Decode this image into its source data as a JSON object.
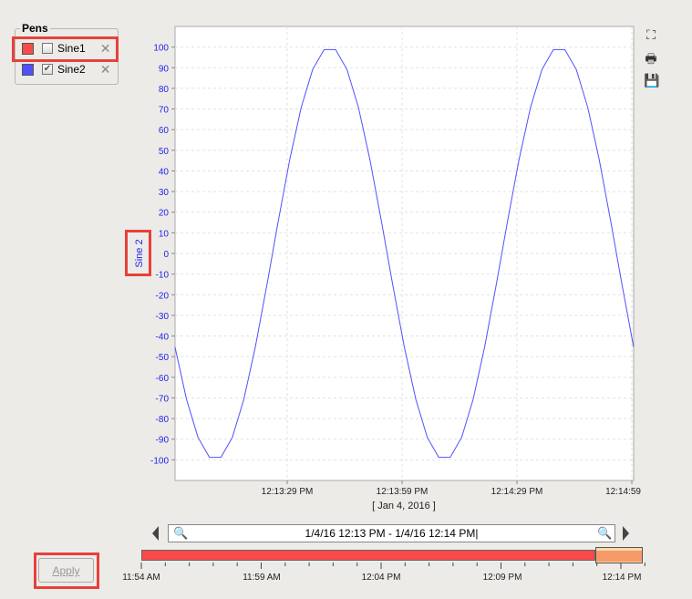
{
  "pens": {
    "title": "Pens",
    "items": [
      {
        "name": "Sine1",
        "color": "#f74b4b",
        "checked": false,
        "highlighted": true
      },
      {
        "name": "Sine2",
        "color": "#5050ff",
        "checked": true,
        "highlighted": false
      }
    ]
  },
  "chart_data": {
    "type": "line",
    "ylabel": "Sine 2",
    "xlabel": "[ Jan 4, 2016 ]",
    "ylim": [
      -110,
      110
    ],
    "yticks": [
      100,
      90,
      80,
      70,
      60,
      50,
      40,
      30,
      20,
      10,
      0,
      -10,
      -20,
      -30,
      -40,
      -50,
      -60,
      -70,
      -80,
      -90,
      -100
    ],
    "xlim": [
      "12:13:00",
      "12:15:00"
    ],
    "xticks": [
      "12:13:29 PM",
      "12:13:59 PM",
      "12:14:29 PM",
      "12:14:59"
    ],
    "grid": true,
    "series": [
      {
        "color": "#5050ff",
        "x": [
          "12:13:00",
          "12:13:03",
          "12:13:06",
          "12:13:09",
          "12:13:12",
          "12:13:15",
          "12:13:18",
          "12:13:21",
          "12:13:24",
          "12:13:27",
          "12:13:30",
          "12:13:33",
          "12:13:36",
          "12:13:39",
          "12:13:42",
          "12:13:45",
          "12:13:48",
          "12:13:51",
          "12:13:54",
          "12:13:57",
          "12:14:00",
          "12:14:03",
          "12:14:06",
          "12:14:09",
          "12:14:12",
          "12:14:15",
          "12:14:18",
          "12:14:21",
          "12:14:24",
          "12:14:27",
          "12:14:30",
          "12:14:33",
          "12:14:36",
          "12:14:39",
          "12:14:42",
          "12:14:45",
          "12:14:48",
          "12:14:51",
          "12:14:54",
          "12:14:57",
          "12:15:00"
        ],
        "values": [
          -45.4,
          -70.7,
          -89.1,
          -98.8,
          -98.8,
          -89.1,
          -70.7,
          -45.4,
          -15.6,
          15.6,
          45.4,
          70.7,
          89.1,
          98.8,
          98.8,
          89.1,
          70.7,
          45.4,
          15.6,
          -15.6,
          -45.4,
          -70.7,
          -89.1,
          -98.8,
          -98.8,
          -89.1,
          -70.7,
          -45.4,
          -15.6,
          15.6,
          45.4,
          70.7,
          89.1,
          98.8,
          98.8,
          89.1,
          70.7,
          45.4,
          15.6,
          -15.6,
          -45.4
        ]
      }
    ]
  },
  "toolbar": {
    "icons": [
      "zoom-fit-icon",
      "print-icon",
      "save-icon"
    ]
  },
  "range": {
    "text": "1/4/16 12:13 PM - 1/4/16 12:14 PM",
    "zoom_out": "zoom-out-icon",
    "zoom_in": "zoom-in-icon"
  },
  "timeline": {
    "labels": [
      "11:54 AM",
      "11:59 AM",
      "12:04 PM",
      "12:09 PM",
      "12:14 PM"
    ],
    "start": "11:54 AM",
    "end": "12:15 PM",
    "selection": [
      "12:13 PM",
      "12:15 PM"
    ],
    "bar_color": "#f74b4b",
    "selection_color": "#f79a6a"
  },
  "apply": {
    "label": "Apply",
    "enabled": false
  }
}
